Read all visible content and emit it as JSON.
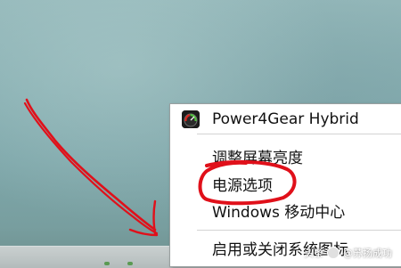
{
  "context_menu": {
    "app_item": {
      "label": "Power4Gear Hybrid",
      "icon": "power4gear-icon"
    },
    "items": [
      {
        "label": "调整屏幕亮度"
      },
      {
        "label": "电源选项"
      },
      {
        "label": "Windows 移动中心"
      },
      {
        "label": "启用或关闭系统图标"
      }
    ]
  },
  "watermark": {
    "prefix": "头条",
    "author": "@苏扬成功"
  },
  "colors": {
    "annotation_red": "#e0101a",
    "menu_background": "#ffffff",
    "taskbar": "#c4cbcb"
  }
}
